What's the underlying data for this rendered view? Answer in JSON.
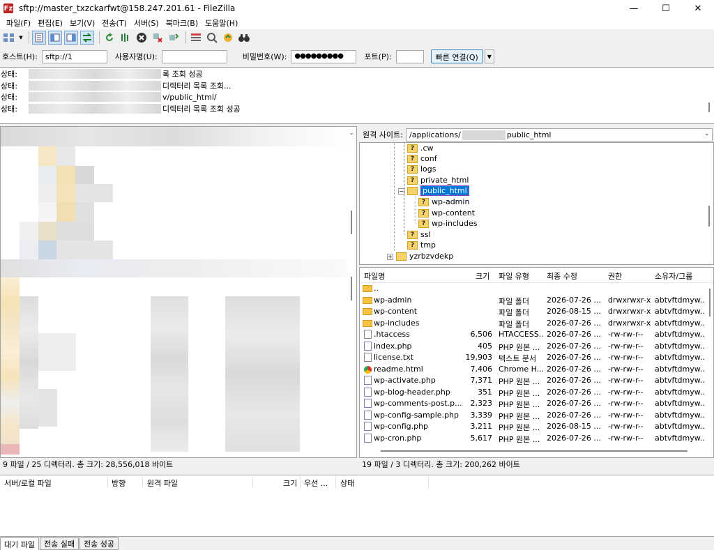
{
  "window": {
    "title": "sftp://master_txzckarfwt@158.247.201.61 - FileZilla",
    "app_icon": "Fz",
    "minimize": "—",
    "maximize": "☐",
    "close": "✕"
  },
  "menu": [
    "파일(F)",
    "편집(E)",
    "보기(V)",
    "전송(T)",
    "서버(S)",
    "북마크(B)",
    "도움말(H)"
  ],
  "quickconnect": {
    "host_label": "호스트(H):",
    "host_value": "sftp://1",
    "user_label": "사용자명(U):",
    "password_label": "비밀번호(W):",
    "password_value": "●●●●●●●●●",
    "port_label": "포트(P):",
    "port_value": "",
    "connect_button": "빠른 연결(Q)"
  },
  "log": [
    {
      "label": "상태:",
      "text": "록 조회 성공"
    },
    {
      "label": "상태:",
      "text": "디렉터리 목록 조회..."
    },
    {
      "label": "상태:",
      "text": "v/public_html/"
    },
    {
      "label": "상태:",
      "text": "디렉터리 목록 조회 성공"
    }
  ],
  "remote": {
    "site_label": "원격 사이트:",
    "path_prefix": "/applications/",
    "path_suffix": "public_html",
    "tree": [
      {
        "name": ".cw",
        "type": "unknown"
      },
      {
        "name": "conf",
        "type": "unknown"
      },
      {
        "name": "logs",
        "type": "unknown"
      },
      {
        "name": "private_html",
        "type": "unknown"
      },
      {
        "name": "public_html",
        "type": "open",
        "selected": true
      },
      {
        "name": "wp-admin",
        "type": "unknown"
      },
      {
        "name": "wp-content",
        "type": "unknown"
      },
      {
        "name": "wp-includes",
        "type": "unknown"
      },
      {
        "name": "ssl",
        "type": "unknown"
      },
      {
        "name": "tmp",
        "type": "unknown"
      },
      {
        "name": "yzrbzvdekp",
        "type": "folder"
      }
    ],
    "columns": {
      "name": "파일명",
      "size": "크기",
      "type": "파일 유형",
      "modified": "최종 수정",
      "perms": "권한",
      "owner": "소유자/그룹"
    },
    "files": [
      {
        "icon": "folder",
        "name": "..",
        "size": "",
        "type": "",
        "modified": "",
        "perms": "",
        "owner": ""
      },
      {
        "icon": "folder",
        "name": "wp-admin",
        "size": "",
        "type": "파일 폴더",
        "modified": "2026-07-26 ...",
        "perms": "drwxrwxr-x",
        "owner": "abtvftdmyw..."
      },
      {
        "icon": "folder",
        "name": "wp-content",
        "size": "",
        "type": "파일 폴더",
        "modified": "2026-08-15 ...",
        "perms": "drwxrwxr-x",
        "owner": "abtvftdmyw..."
      },
      {
        "icon": "folder",
        "name": "wp-includes",
        "size": "",
        "type": "파일 폴더",
        "modified": "2026-07-26 ...",
        "perms": "drwxrwxr-x",
        "owner": "abtvftdmyw..."
      },
      {
        "icon": "file",
        "name": ".htaccess",
        "size": "6,506",
        "type": "HTACCESS...",
        "modified": "2026-07-26 ...",
        "perms": "-rw-rw-r--",
        "owner": "abtvftdmyw..."
      },
      {
        "icon": "php",
        "name": "index.php",
        "size": "405",
        "type": "PHP 원본 ...",
        "modified": "2026-07-26 ...",
        "perms": "-rw-rw-r--",
        "owner": "abtvftdmyw..."
      },
      {
        "icon": "file",
        "name": "license.txt",
        "size": "19,903",
        "type": "텍스트 문서",
        "modified": "2026-07-26 ...",
        "perms": "-rw-rw-r--",
        "owner": "abtvftdmyw..."
      },
      {
        "icon": "chrome",
        "name": "readme.html",
        "size": "7,406",
        "type": "Chrome H...",
        "modified": "2026-07-26 ...",
        "perms": "-rw-rw-r--",
        "owner": "abtvftdmyw..."
      },
      {
        "icon": "php",
        "name": "wp-activate.php",
        "size": "7,371",
        "type": "PHP 원본 ...",
        "modified": "2026-07-26 ...",
        "perms": "-rw-rw-r--",
        "owner": "abtvftdmyw..."
      },
      {
        "icon": "php",
        "name": "wp-blog-header.php",
        "size": "351",
        "type": "PHP 원본 ...",
        "modified": "2026-07-26 ...",
        "perms": "-rw-rw-r--",
        "owner": "abtvftdmyw..."
      },
      {
        "icon": "php",
        "name": "wp-comments-post.p...",
        "size": "2,323",
        "type": "PHP 원본 ...",
        "modified": "2026-07-26 ...",
        "perms": "-rw-rw-r--",
        "owner": "abtvftdmyw..."
      },
      {
        "icon": "php",
        "name": "wp-config-sample.php",
        "size": "3,339",
        "type": "PHP 원본 ...",
        "modified": "2026-07-26 ...",
        "perms": "-rw-rw-r--",
        "owner": "abtvftdmyw..."
      },
      {
        "icon": "php",
        "name": "wp-config.php",
        "size": "3,211",
        "type": "PHP 원본 ...",
        "modified": "2026-08-15 ...",
        "perms": "-rw-rw-r--",
        "owner": "abtvftdmyw..."
      },
      {
        "icon": "php",
        "name": "wp-cron.php",
        "size": "5,617",
        "type": "PHP 원본 ...",
        "modified": "2026-07-26 ...",
        "perms": "-rw-rw-r--",
        "owner": "abtvftdmyw..."
      }
    ]
  },
  "status": {
    "local": "9 파일 / 25 디렉터리. 총 크기: 28,556,018 바이트",
    "remote": "19 파일 / 3 디렉터리. 총 크기: 200,262 바이트"
  },
  "queue": {
    "columns": [
      "서버/로컬 파일",
      "방향",
      "원격 파일",
      "크기",
      "우선 ...",
      "상태"
    ]
  },
  "tabs": [
    "대기 파일",
    "전송 실패",
    "전송 성공"
  ]
}
